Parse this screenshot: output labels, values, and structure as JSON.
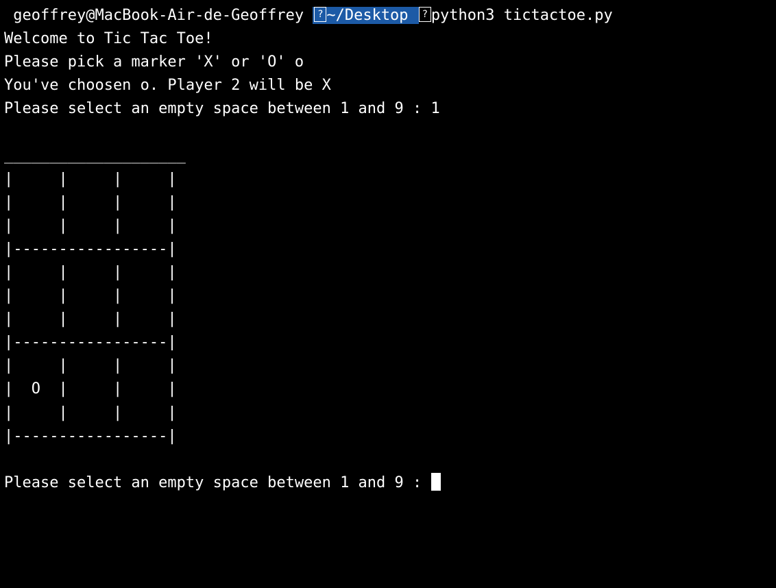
{
  "prompt": {
    "user_host": " geoffrey@MacBook-Air-de-Geoffrey ",
    "path": "~/Desktop",
    "command": "python3 tictactoe.py"
  },
  "lines": {
    "welcome": "Welcome to Tic Tac Toe!",
    "pick_marker": "Please pick a marker 'X' or 'O' o",
    "chosen": "You've choosen o. Player 2 will be X",
    "select1": "Please select an empty space between 1 and 9 : 1",
    "board_top": "____________________",
    "board_r1a": "|     |     |     |",
    "board_r1b": "|     |     |     |",
    "board_r1c": "|     |     |     |",
    "board_sep1": "|-----------------|",
    "board_r2a": "|     |     |     |",
    "board_r2b": "|     |     |     |",
    "board_r2c": "|     |     |     |",
    "board_sep2": "|-----------------|",
    "board_r3a": "|     |     |     |",
    "board_r3b": "|  O  |     |     |",
    "board_r3c": "|     |     |     |",
    "board_sep3": "|-----------------|",
    "select2": "Please select an empty space between 1 and 9 : "
  },
  "game_state": {
    "player1_marker": "O",
    "player2_marker": "X",
    "board": [
      " ",
      " ",
      " ",
      " ",
      " ",
      " ",
      "O",
      " ",
      " "
    ],
    "last_move": 1,
    "awaiting_input": true
  }
}
